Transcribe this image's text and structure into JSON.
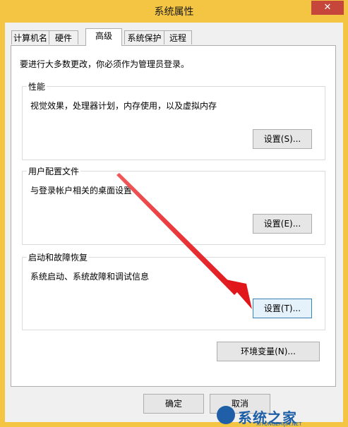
{
  "window": {
    "title": "系统属性",
    "close_glyph": "✕"
  },
  "tabs": [
    {
      "label": "计算机名"
    },
    {
      "label": "硬件"
    },
    {
      "label": "高级"
    },
    {
      "label": "系统保护"
    },
    {
      "label": "远程"
    }
  ],
  "active_tab": "高级",
  "notice": "要进行大多数更改，你必须作为管理员登录。",
  "groups": {
    "performance": {
      "title": "性能",
      "description": "视觉效果，处理器计划，内存使用，以及虚拟内存",
      "button": "设置(S)..."
    },
    "user_profiles": {
      "title": "用户配置文件",
      "description": "与登录帐户相关的桌面设置",
      "button": "设置(E)..."
    },
    "startup_recovery": {
      "title": "启动和故障恢复",
      "description": "系统启动、系统故障和调试信息",
      "button": "设置(T)..."
    }
  },
  "env_button": "环境变量(N)...",
  "footer": {
    "ok": "确定",
    "cancel": "取消"
  },
  "watermark": {
    "text": "系统之家",
    "url": "XITONGZHIJIA.NET"
  },
  "colors": {
    "titlebar": "#f4c542",
    "close": "#c7463b",
    "arrow": "#e8262a",
    "watermark": "#1e5fa8"
  }
}
